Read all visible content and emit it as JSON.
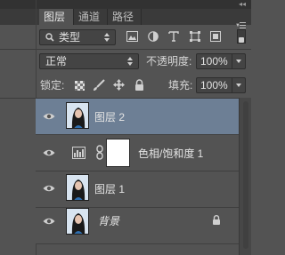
{
  "panel": {
    "tabs": [
      {
        "label": "图层",
        "active": true
      },
      {
        "label": "通道",
        "active": false
      },
      {
        "label": "路径",
        "active": false
      }
    ]
  },
  "filter": {
    "kind_label": "类型",
    "icons": [
      "image-filter-icon",
      "adjustment-filter-icon",
      "type-filter-icon",
      "shape-filter-icon",
      "smart-object-filter-icon",
      "filter-toggle-icon"
    ]
  },
  "blend": {
    "mode": "正常",
    "opacity_label": "不透明度:",
    "opacity_value": "100%"
  },
  "lock": {
    "label": "锁定:",
    "fill_label": "填充:",
    "fill_value": "100%"
  },
  "layers": [
    {
      "name": "图层 2",
      "selected": true,
      "type": "pixel"
    },
    {
      "name": "色相/饱和度 1",
      "selected": false,
      "type": "adjustment"
    },
    {
      "name": "图层 1",
      "selected": false,
      "type": "pixel"
    },
    {
      "name": "背景",
      "selected": false,
      "type": "background",
      "locked": true
    }
  ],
  "colors": {
    "panel_bg": "#535353",
    "selected_row": "#6d7f95",
    "tab_bar": "#3a3a3a"
  }
}
